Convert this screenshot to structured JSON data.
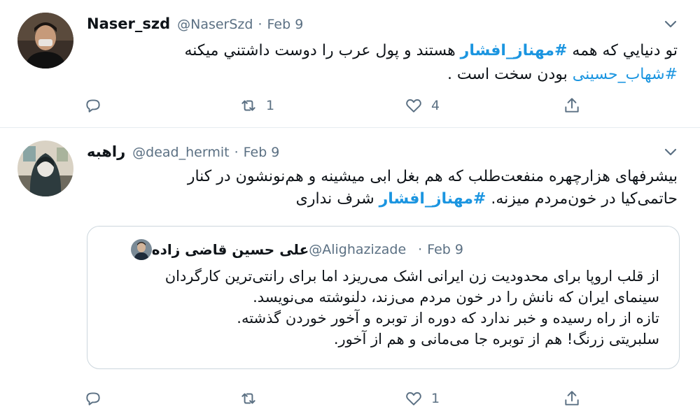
{
  "tweets": [
    {
      "author_name": "Naser_szd",
      "handle": "@NaserSzd",
      "separator": "·",
      "date": "Feb 9",
      "text_part1": "تو دنيايي که همه ",
      "hashtag1": "#مهناز_افشار",
      "text_part2": " هستند و پول عرب را دوست داشتني ميکنه",
      "hashtag2": "#شهاب_حسینی",
      "text_part3": " بودن سخت است .",
      "retweets": "1",
      "likes": "4"
    },
    {
      "author_name": "راهبه",
      "handle": "@dead_hermit",
      "separator": "·",
      "date": "Feb 9",
      "text_part1": "بیشرفهای هزارچهره منفعت‌طلب که هم بغل ابی میشینه و هم‌نونشون در کنار حاتمی‌کیا در خون‌مردم میزنه. ",
      "hashtag1": "#مهناز_افشار",
      "text_part2": " شرف نداری",
      "retweets": "",
      "likes": "1",
      "quoted": {
        "author_name": "علی حسین قاضی زاده",
        "handle": "@Alighazizade",
        "separator": "·",
        "date": "Feb 9",
        "line1": "از قلب اروپا برای محدودیت زن ایرانی اشک می‌ریزد اما برای رانتی‌ترین کارگردان",
        "line2": "سینمای ایران که نانش را در خون مردم می‌زند، دلنوشته می‌نویسد.",
        "line3": "تازه از راه رسیده و خبر ندارد که دوره از توبره و آخور خوردن گذشته.",
        "line4": "سلبریتی زرنگ! هم از توبره جا می‌مانی و هم از آخور."
      }
    }
  ],
  "colors": {
    "link": "#1b95e0",
    "muted": "#5b7083",
    "border": "#e6ecf0"
  },
  "icons": [
    "avatar-photo",
    "chevron-down-icon",
    "reply-icon",
    "retweet-icon",
    "like-icon",
    "share-icon"
  ]
}
